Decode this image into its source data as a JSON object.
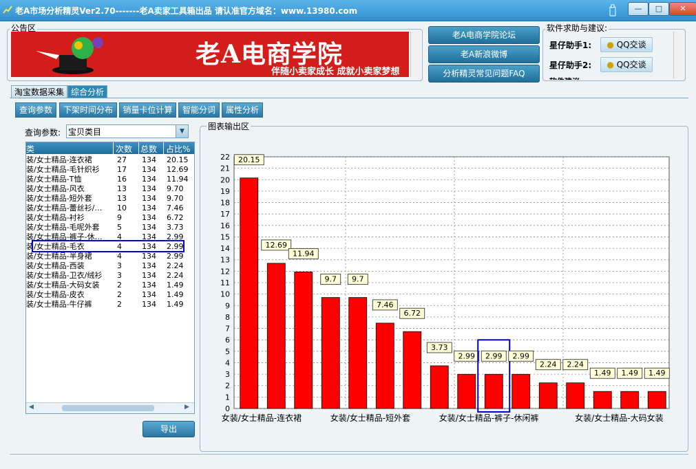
{
  "window": {
    "title": "老A市场分析精灵Ver2.70-------老A卖家工具箱出品   请认准官方域名：www.13980.com",
    "minimize_label": "—",
    "maximize_label": "□",
    "close_label": "✕"
  },
  "notice": {
    "title": "公告区",
    "banner_title": "老A电商学院",
    "banner_subtitle": "伴随小卖家成长   成就小卖家梦想"
  },
  "links": [
    "老A电商学院论坛",
    "老A新浪微博",
    "分析精灵常见问题FAQ"
  ],
  "help": {
    "title": "软件求助与建议:",
    "helpers": [
      {
        "label": "星仔助手1:",
        "button": "QQ交谈"
      },
      {
        "label": "星仔助手2:",
        "button": "QQ交谈"
      }
    ],
    "partial_label": "软件建议:"
  },
  "tabs": [
    "淘宝数据采集",
    "综合分析"
  ],
  "function_buttons": [
    "查询参数",
    "下架时间分布",
    "销量卡位计算",
    "智能分词",
    "属性分析"
  ],
  "query": {
    "label": "查询参数:",
    "value": "宝贝类目"
  },
  "table": {
    "headers": [
      "类",
      "次数",
      "总数",
      "占比%"
    ],
    "rows": [
      [
        "装/女士精品-连衣裙",
        "27",
        "134",
        "20.15"
      ],
      [
        "装/女士精品-毛针织衫",
        "17",
        "134",
        "12.69"
      ],
      [
        "装/女士精品-T恤",
        "16",
        "134",
        "11.94"
      ],
      [
        "装/女士精品-风衣",
        "13",
        "134",
        "9.70"
      ],
      [
        "装/女士精品-短外套",
        "13",
        "134",
        "9.70"
      ],
      [
        "装/女士精品-蕾丝衫/…",
        "10",
        "134",
        "7.46"
      ],
      [
        "装/女士精品-衬衫",
        "9",
        "134",
        "6.72"
      ],
      [
        "装/女士精品-毛呢外套",
        "5",
        "134",
        "3.73"
      ],
      [
        "装/女士精品-裤子-休…",
        "4",
        "134",
        "2.99"
      ],
      [
        "装/女士精品-毛衣",
        "4",
        "134",
        "2.99"
      ],
      [
        "装/女士精品-半身裙",
        "4",
        "134",
        "2.99"
      ],
      [
        "装/女士精品-西装",
        "3",
        "134",
        "2.24"
      ],
      [
        "装/女士精品-卫衣/绒衫",
        "3",
        "134",
        "2.24"
      ],
      [
        "装/女士精品-大码女装",
        "2",
        "134",
        "1.49"
      ],
      [
        "装/女士精品-皮衣",
        "2",
        "134",
        "1.49"
      ],
      [
        "装/女士精品-牛仔裤",
        "2",
        "134",
        "1.49"
      ]
    ]
  },
  "export_label": "导出",
  "chart_area_title": "图表输出区",
  "colors": {
    "bar": "#ff0000",
    "highlight": "#0000cc",
    "button": "#2a76a4"
  },
  "chart_data": {
    "type": "bar",
    "values": [
      20.15,
      12.69,
      11.94,
      9.7,
      9.7,
      7.46,
      6.72,
      3.73,
      2.99,
      2.99,
      2.99,
      2.24,
      2.24,
      1.49,
      1.49,
      1.49
    ],
    "data_labels": [
      "20.15",
      "12.69",
      "11.94",
      "9.7",
      "9.7",
      "7.46",
      "6.72",
      "3.73",
      "2.99",
      "2.99",
      "2.99",
      "2.24",
      "2.24",
      "1.49",
      "1.49",
      "1.49"
    ],
    "visible_category_labels": [
      {
        "index": 0,
        "text": "女装/女士精品-连衣裙"
      },
      {
        "index": 4,
        "text": "女装/女士精品-短外套"
      },
      {
        "index": 8,
        "text": "女装/女士精品-裤子-休闲裤"
      },
      {
        "index": 13,
        "text": "女装/女士精品-大码女装"
      }
    ],
    "ylim": [
      0,
      22
    ],
    "yticks": [
      0,
      1,
      2,
      3,
      4,
      5,
      6,
      7,
      8,
      9,
      10,
      11,
      12,
      13,
      14,
      15,
      16,
      17,
      18,
      19,
      20,
      21,
      22
    ],
    "grid": true,
    "highlighted_index": 9
  }
}
